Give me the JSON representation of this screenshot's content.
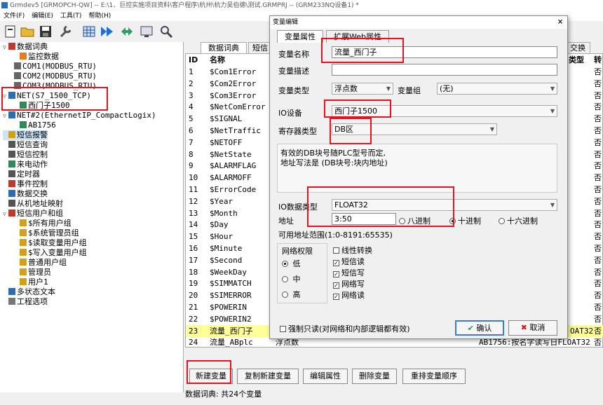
{
  "title": "Grmdev5 [GRMOPCH-QW] -- E:\\1、巨控实施项目资料\\客户程序\\杭州\\杭力吴伯德\\测试.GRMPRJ -- (GRM233NQ设备1) *",
  "menu": [
    "文件(F)",
    "编辑(E)",
    "工具(T)",
    "帮助(H)"
  ],
  "toolbar_icons": [
    "new-file-icon",
    "open-folder-icon",
    "save-icon",
    "tools-icon",
    "grid-icon",
    "download-icon",
    "connect-icon",
    "monitor-icon",
    "search-icon"
  ],
  "tree": [
    {
      "label": "数据词典",
      "indent": 0,
      "exp": "▽",
      "icon": "book"
    },
    {
      "label": "监控数据",
      "indent": 2,
      "exp": "",
      "icon": "monitor"
    },
    {
      "label": "COM1(MODBUS_RTU)",
      "indent": 1,
      "exp": "",
      "icon": "com"
    },
    {
      "label": "COM2(MODBUS_RTU)",
      "indent": 1,
      "exp": "",
      "icon": "com"
    },
    {
      "label": "COM3(MODBUS_RTU)",
      "indent": 1,
      "exp": "",
      "icon": "com"
    },
    {
      "label": "NET(S7_1500_TCP)",
      "indent": 0,
      "exp": "▽",
      "icon": "net"
    },
    {
      "label": "西门子1500",
      "indent": 2,
      "exp": "",
      "icon": "plc"
    },
    {
      "label": "NET#2(EthernetIP_CompactLogix)",
      "indent": 0,
      "exp": "▽",
      "icon": "net"
    },
    {
      "label": "AB1756",
      "indent": 2,
      "exp": "",
      "icon": "plc"
    },
    {
      "label": "短信报警",
      "indent": 0,
      "exp": "",
      "icon": "alarm"
    },
    {
      "label": "短信查询",
      "indent": 0,
      "exp": "",
      "icon": "query"
    },
    {
      "label": "短信控制",
      "indent": 0,
      "exp": "",
      "icon": "control"
    },
    {
      "label": "来电动作",
      "indent": 0,
      "exp": "",
      "icon": "phone"
    },
    {
      "label": "定时器",
      "indent": 0,
      "exp": "",
      "icon": "timer"
    },
    {
      "label": "事件控制",
      "indent": 0,
      "exp": "",
      "icon": "event"
    },
    {
      "label": "数据交换",
      "indent": 0,
      "exp": "",
      "icon": "exchange"
    },
    {
      "label": "从机地址映射",
      "indent": 0,
      "exp": "",
      "icon": "map"
    },
    {
      "label": "短信用户和组",
      "indent": 0,
      "exp": "▽",
      "icon": "users"
    },
    {
      "label": "$所有用户组",
      "indent": 2,
      "exp": "",
      "icon": "group"
    },
    {
      "label": "$系统管理员组",
      "indent": 2,
      "exp": "",
      "icon": "group"
    },
    {
      "label": "$读取变量用户组",
      "indent": 2,
      "exp": "",
      "icon": "group"
    },
    {
      "label": "$写入变量用户组",
      "indent": 2,
      "exp": "",
      "icon": "group"
    },
    {
      "label": "普通用户组",
      "indent": 2,
      "exp": "",
      "icon": "group"
    },
    {
      "label": "管理员",
      "indent": 2,
      "exp": "",
      "icon": "user"
    },
    {
      "label": "用户1",
      "indent": 2,
      "exp": "",
      "icon": "user"
    },
    {
      "label": "多状态文本",
      "indent": 0,
      "exp": "",
      "icon": "text"
    },
    {
      "label": "工程选项",
      "indent": 0,
      "exp": "",
      "icon": "option"
    }
  ],
  "tabs": {
    "t1": "数据词典",
    "t2": "短信",
    "t3": "交换"
  },
  "headers": {
    "id": "ID",
    "name": "名称",
    "type": "类型",
    "conv": "转"
  },
  "rows": [
    {
      "id": "1",
      "name": "$Com1Error",
      "type": "",
      "conv": "否"
    },
    {
      "id": "2",
      "name": "$Com2Error",
      "type": "",
      "conv": "否"
    },
    {
      "id": "3",
      "name": "$Com3Error",
      "type": "",
      "conv": "否"
    },
    {
      "id": "4",
      "name": "$NetComError",
      "type": "",
      "conv": "否"
    },
    {
      "id": "5",
      "name": "$SIGNAL",
      "type": "",
      "conv": "否"
    },
    {
      "id": "6",
      "name": "$NetTraffic",
      "type": "",
      "conv": "否"
    },
    {
      "id": "7",
      "name": "$NETOFF",
      "type": "",
      "conv": "否"
    },
    {
      "id": "8",
      "name": "$NetState",
      "type": "",
      "conv": "否"
    },
    {
      "id": "9",
      "name": "$ALARMFLAG",
      "type": "",
      "conv": "否"
    },
    {
      "id": "10",
      "name": "$ALARMOFF",
      "type": "",
      "conv": "否"
    },
    {
      "id": "11",
      "name": "$ErrorCode",
      "type": "",
      "conv": "否"
    },
    {
      "id": "12",
      "name": "$Year",
      "type": "",
      "conv": "否"
    },
    {
      "id": "13",
      "name": "$Month",
      "type": "",
      "conv": "否"
    },
    {
      "id": "14",
      "name": "$Day",
      "type": "",
      "conv": "否"
    },
    {
      "id": "15",
      "name": "$Hour",
      "type": "",
      "conv": "否"
    },
    {
      "id": "16",
      "name": "$Minute",
      "type": "",
      "conv": "否"
    },
    {
      "id": "17",
      "name": "$Second",
      "type": "",
      "conv": "否"
    },
    {
      "id": "18",
      "name": "$WeekDay",
      "type": "",
      "conv": "否"
    },
    {
      "id": "19",
      "name": "$SIMMATCH",
      "type": "",
      "conv": "否"
    },
    {
      "id": "20",
      "name": "$SIMERROR",
      "type": "",
      "conv": "否"
    },
    {
      "id": "21",
      "name": "$POWERIN",
      "type": "",
      "conv": "否"
    },
    {
      "id": "22",
      "name": "$POWERIN2",
      "type": "",
      "conv": "否"
    },
    {
      "id": "23",
      "name": "流量_西门子",
      "type": "OAT32",
      "conv": "否"
    },
    {
      "id": "24",
      "name": "流量_ABplc",
      "type": "浮点数",
      "desc": "AB1756:按名字读写日FLOAT32",
      "conv": "否"
    }
  ],
  "buttons": {
    "new": "新建变量",
    "copy": "复制新建变量",
    "edit": "编辑属性",
    "del": "删除变量",
    "reorder": "重排变量顺序"
  },
  "status": "数据词典: 共24个变量",
  "dialog": {
    "title": "变量编辑",
    "close": "×",
    "tab1": "变量属性",
    "tab2": "扩展Web属性",
    "name_label": "变量名称",
    "name_value": "流量_西门子",
    "desc_label": "变量描述",
    "desc_value": "",
    "type_label": "变量类型",
    "type_value": "浮点数",
    "group_label": "变量组",
    "group_value": "(无)",
    "io_label": "IO设备",
    "io_value": "西门子1500",
    "reg_label": "寄存器类型",
    "reg_value": "DB区",
    "hint1": "有效的DB块号随PLC型号而定,",
    "hint2": "地址写法是 (DB块号:块内地址)",
    "dtype_label": "IO数据类型",
    "dtype_value": "FLOAT32",
    "addr_label": "地址",
    "addr_value": "3:50",
    "radix_oct": "八进制",
    "radix_dec": "十进制",
    "radix_hex": "十六进制",
    "range": "可用地址范围(1:0-8191:65535)",
    "perm_title": "网络权限",
    "perm_low": "低",
    "perm_mid": "中",
    "perm_high": "高",
    "chk_linear": "线性转换",
    "chk_smsread": "短信读",
    "chk_smswrite": "短信写",
    "chk_netwrite": "网络写",
    "chk_netread": "网络读",
    "force_ro": "强制只读(对网络和内部逻辑都有效)",
    "ok": "确认",
    "cancel": "取消"
  },
  "colors": {
    "highlight": "#e8121e",
    "row_select": "#ffff99",
    "tree_select": "#cce4f7"
  }
}
